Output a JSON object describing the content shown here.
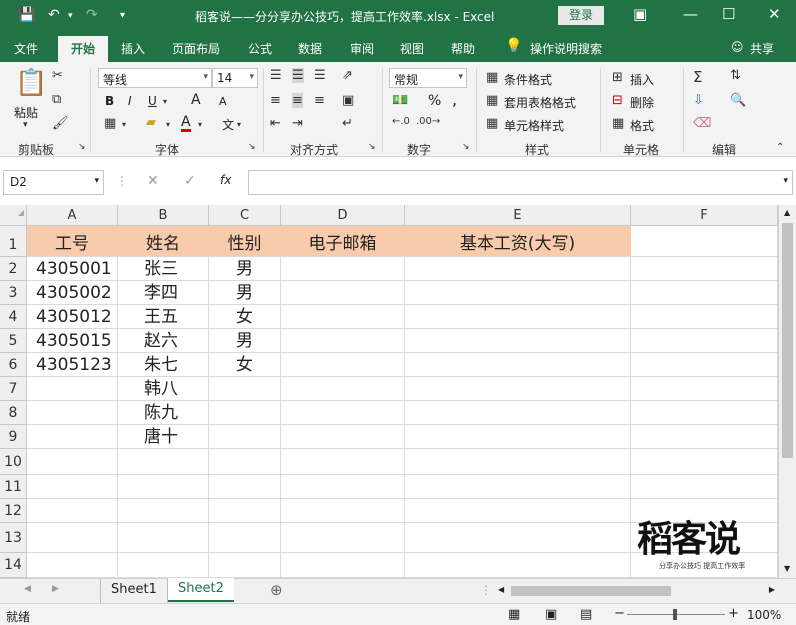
{
  "window": {
    "title": "稻客说——分分享办公技巧，提高工作效率.xlsx  -  Excel",
    "login_label": "登录"
  },
  "ribbon_tabs": [
    "文件",
    "开始",
    "插入",
    "页面布局",
    "公式",
    "数据",
    "审阅",
    "视图",
    "帮助",
    "操作说明搜索"
  ],
  "share_label": "共享",
  "ribbon": {
    "clipboard": {
      "paste": "粘贴",
      "label": "剪贴板"
    },
    "font": {
      "name": "等线",
      "size": "14",
      "label": "字体",
      "bold": "B",
      "italic": "I",
      "underline": "U",
      "grow": "A",
      "shrink": "A",
      "color": "A",
      "phonetic": "文"
    },
    "alignment": {
      "label": "对齐方式"
    },
    "number": {
      "format": "常规",
      "label": "数字",
      "percent": "%",
      "comma": ","
    },
    "styles": {
      "conditional": "条件格式",
      "table": "套用表格格式",
      "cell": "单元格样式",
      "label": "样式"
    },
    "cells": {
      "insert": "插入",
      "delete": "删除",
      "format": "格式",
      "label": "单元格"
    },
    "editing": {
      "label": "编辑"
    }
  },
  "formula_bar": {
    "name_box": "D2",
    "fx": "fx",
    "content": ""
  },
  "grid": {
    "columns": [
      "A",
      "B",
      "C",
      "D",
      "E",
      "F"
    ],
    "rows": [
      "1",
      "2",
      "3",
      "4",
      "5",
      "6",
      "7",
      "8",
      "9",
      "10",
      "11",
      "12",
      "13",
      "14"
    ],
    "header_row": [
      "工号",
      "姓名",
      "性别",
      "电子邮箱",
      "基本工资(大写)"
    ],
    "data": [
      [
        "4305001",
        "张三",
        "男"
      ],
      [
        "4305002",
        "李四",
        "男"
      ],
      [
        "4305012",
        "王五",
        "女"
      ],
      [
        "4305015",
        "赵六",
        "男"
      ],
      [
        "4305123",
        "朱七",
        "女"
      ],
      [
        "",
        "韩八",
        ""
      ],
      [
        "",
        "陈九",
        ""
      ],
      [
        "",
        "唐十",
        ""
      ]
    ],
    "header_fill": "#F8CBAD"
  },
  "sheets": [
    "Sheet1",
    "Sheet2"
  ],
  "active_sheet": "Sheet2",
  "status": {
    "ready": "就绪",
    "zoom": "100%"
  },
  "watermark": {
    "brand": "稻客说",
    "tagline": "分享办公技巧 提高工作效率"
  },
  "colors": {
    "accent": "#217346"
  }
}
